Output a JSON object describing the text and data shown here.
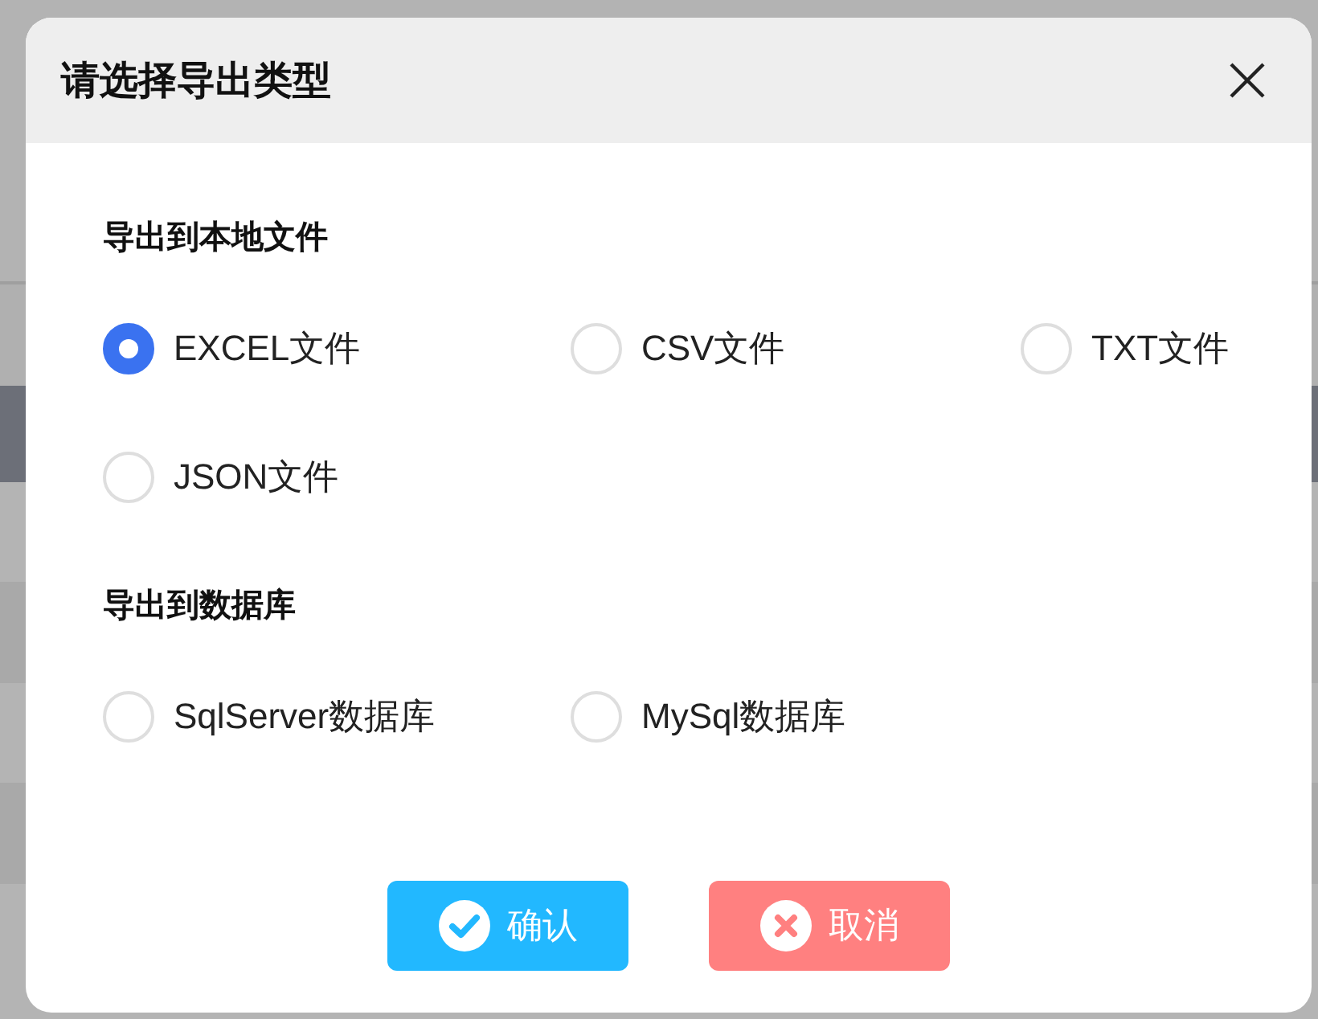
{
  "dialog": {
    "title": "请选择导出类型",
    "sections": [
      {
        "title": "导出到本地文件",
        "options": [
          {
            "label": "EXCEL文件",
            "selected": true
          },
          {
            "label": "CSV文件",
            "selected": false
          },
          {
            "label": "TXT文件",
            "selected": false
          },
          {
            "label": "JSON文件",
            "selected": false
          }
        ]
      },
      {
        "title": "导出到数据库",
        "options": [
          {
            "label": "SqlServer数据库",
            "selected": false
          },
          {
            "label": "MySql数据库",
            "selected": false
          }
        ]
      }
    ],
    "buttons": [
      {
        "label": "确认",
        "kind": "confirm"
      },
      {
        "label": "取消",
        "kind": "cancel"
      }
    ]
  }
}
